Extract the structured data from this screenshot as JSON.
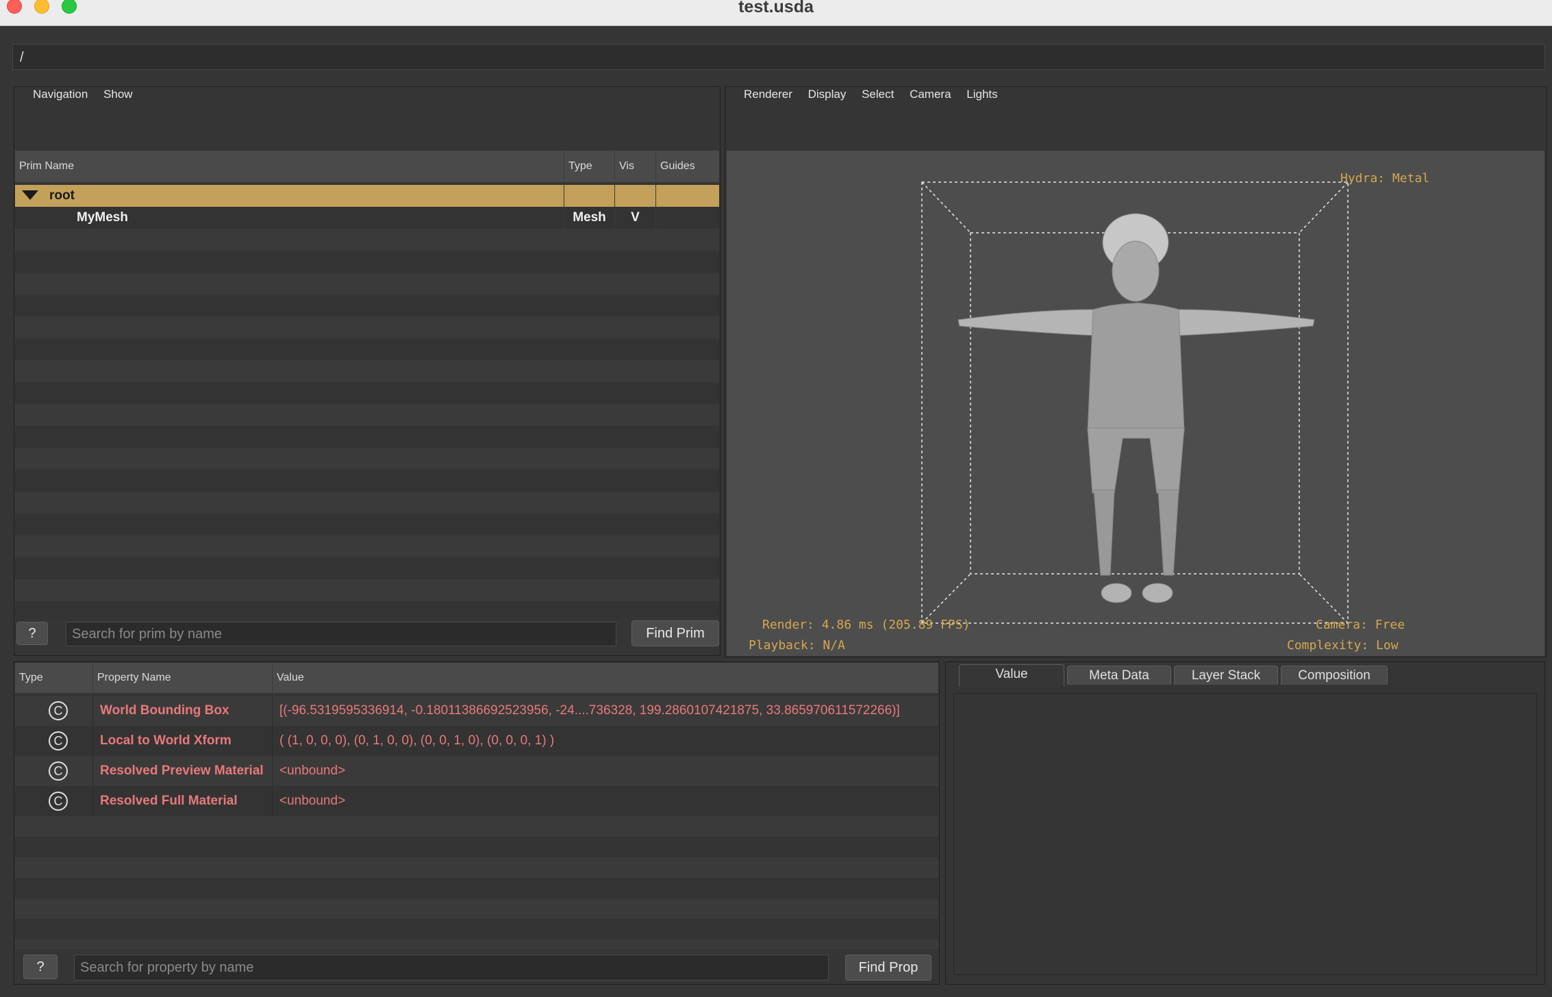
{
  "window": {
    "title": "test.usda"
  },
  "path_bar": {
    "value": "/"
  },
  "prim_panel": {
    "menu": [
      "Navigation",
      "Show"
    ],
    "columns": [
      "Prim Name",
      "Type",
      "Vis",
      "Guides"
    ],
    "rows": [
      {
        "name": "root",
        "type": "",
        "vis": "",
        "guides": "",
        "expanded": true,
        "selected": true
      },
      {
        "name": "MyMesh",
        "type": "Mesh",
        "vis": "V",
        "guides": ""
      }
    ],
    "help_label": "?",
    "search_placeholder": "Search for prim by name",
    "find_label": "Find Prim"
  },
  "viewport": {
    "menu": [
      "Renderer",
      "Display",
      "Select",
      "Camera",
      "Lights"
    ],
    "hud": {
      "renderer": "Hydra: Metal",
      "render_time": "Render: 4.86 ms (205.89 FPS)",
      "playback": "Playback: N/A",
      "camera": "Camera: Free",
      "complexity": "Complexity: Low"
    },
    "colors": {
      "hud": "#d6a84f",
      "background": "#4d4d4d"
    }
  },
  "property_panel": {
    "columns": [
      "Type",
      "Property Name",
      "Value"
    ],
    "type_icon": "C",
    "rows": [
      {
        "name": "World Bounding Box",
        "value": "[(-96.5319595336914, -0.18011386692523956, -24....736328, 199.2860107421875, 33.865970611572266)]"
      },
      {
        "name": "Local to World Xform",
        "value": "( (1, 0, 0, 0), (0, 1, 0, 0), (0, 0, 1, 0), (0, 0, 0, 1) )"
      },
      {
        "name": "Resolved Preview Material",
        "value": "<unbound>"
      },
      {
        "name": "Resolved Full Material",
        "value": "<unbound>"
      }
    ],
    "help_label": "?",
    "search_placeholder": "Search for property by name",
    "find_label": "Find Prop",
    "colors": {
      "computed_property": "#e8797a"
    }
  },
  "inspector": {
    "tabs": [
      "Value",
      "Meta Data",
      "Layer Stack",
      "Composition"
    ],
    "active_tab": "Value"
  },
  "colors": {
    "selection": "#c3a15a"
  }
}
